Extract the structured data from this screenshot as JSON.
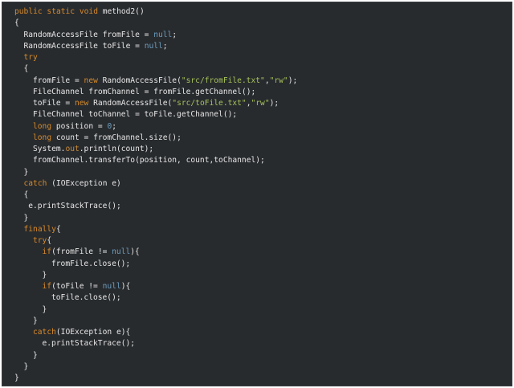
{
  "editor": {
    "lines": [
      {
        "indent": 0,
        "tokens": [
          {
            "t": "public static void ",
            "c": "kw"
          },
          {
            "t": "method2()",
            "c": "tx"
          }
        ]
      },
      {
        "indent": 0,
        "tokens": [
          {
            "t": "{",
            "c": "tx"
          }
        ]
      },
      {
        "indent": 1,
        "tokens": [
          {
            "t": "RandomAccessFile fromFile = ",
            "c": "tx"
          },
          {
            "t": "null",
            "c": "lit"
          },
          {
            "t": ";",
            "c": "tx"
          }
        ]
      },
      {
        "indent": 1,
        "tokens": [
          {
            "t": "RandomAccessFile toFile = ",
            "c": "tx"
          },
          {
            "t": "null",
            "c": "lit"
          },
          {
            "t": ";",
            "c": "tx"
          }
        ]
      },
      {
        "indent": 1,
        "tokens": [
          {
            "t": "try",
            "c": "kw"
          }
        ]
      },
      {
        "indent": 1,
        "tokens": [
          {
            "t": "{",
            "c": "tx"
          }
        ]
      },
      {
        "indent": 2,
        "tokens": [
          {
            "t": "fromFile = ",
            "c": "tx"
          },
          {
            "t": "new ",
            "c": "kw"
          },
          {
            "t": "RandomAccessFile(",
            "c": "tx"
          },
          {
            "t": "\"src/fromFile.txt\"",
            "c": "str"
          },
          {
            "t": ",",
            "c": "tx"
          },
          {
            "t": "\"rw\"",
            "c": "str"
          },
          {
            "t": ");",
            "c": "tx"
          }
        ]
      },
      {
        "indent": 2,
        "tokens": [
          {
            "t": "FileChannel fromChannel = fromFile.getChannel();",
            "c": "tx"
          }
        ]
      },
      {
        "indent": 2,
        "tokens": [
          {
            "t": "toFile = ",
            "c": "tx"
          },
          {
            "t": "new ",
            "c": "kw"
          },
          {
            "t": "RandomAccessFile(",
            "c": "tx"
          },
          {
            "t": "\"src/toFile.txt\"",
            "c": "str"
          },
          {
            "t": ",",
            "c": "tx"
          },
          {
            "t": "\"rw\"",
            "c": "str"
          },
          {
            "t": ");",
            "c": "tx"
          }
        ]
      },
      {
        "indent": 2,
        "tokens": [
          {
            "t": "FileChannel toChannel = toFile.getChannel();",
            "c": "tx"
          }
        ]
      },
      {
        "indent": 2,
        "tokens": [
          {
            "t": "long ",
            "c": "kw"
          },
          {
            "t": "position = ",
            "c": "tx"
          },
          {
            "t": "0",
            "c": "lit"
          },
          {
            "t": ";",
            "c": "tx"
          }
        ]
      },
      {
        "indent": 2,
        "tokens": [
          {
            "t": "long ",
            "c": "kw"
          },
          {
            "t": "count = fromChannel.size();",
            "c": "tx"
          }
        ]
      },
      {
        "indent": 2,
        "tokens": [
          {
            "t": "System.",
            "c": "tx"
          },
          {
            "t": "out",
            "c": "fld"
          },
          {
            "t": ".println(count);",
            "c": "tx"
          }
        ]
      },
      {
        "indent": 2,
        "tokens": [
          {
            "t": "fromChannel.transferTo(position, count,toChannel);",
            "c": "tx"
          }
        ]
      },
      {
        "indent": 1,
        "tokens": [
          {
            "t": "}",
            "c": "tx"
          }
        ]
      },
      {
        "indent": 1,
        "tokens": [
          {
            "t": "catch ",
            "c": "kw"
          },
          {
            "t": "(IOException e)",
            "c": "tx"
          }
        ]
      },
      {
        "indent": 1,
        "tokens": [
          {
            "t": "{",
            "c": "tx"
          }
        ]
      },
      {
        "indent": 1.5,
        "tokens": [
          {
            "t": "e.printStackTrace();",
            "c": "tx"
          }
        ]
      },
      {
        "indent": 1,
        "tokens": [
          {
            "t": "}",
            "c": "tx"
          }
        ]
      },
      {
        "indent": 1,
        "tokens": [
          {
            "t": "finally",
            "c": "kw"
          },
          {
            "t": "{",
            "c": "tx"
          }
        ]
      },
      {
        "indent": 2,
        "tokens": [
          {
            "t": "try",
            "c": "kw"
          },
          {
            "t": "{",
            "c": "tx"
          }
        ]
      },
      {
        "indent": 3,
        "tokens": [
          {
            "t": "if",
            "c": "kw"
          },
          {
            "t": "(fromFile != ",
            "c": "tx"
          },
          {
            "t": "null",
            "c": "lit"
          },
          {
            "t": "){",
            "c": "tx"
          }
        ]
      },
      {
        "indent": 4,
        "tokens": [
          {
            "t": "fromFile.close();",
            "c": "tx"
          }
        ]
      },
      {
        "indent": 3,
        "tokens": [
          {
            "t": "}",
            "c": "tx"
          }
        ]
      },
      {
        "indent": 3,
        "tokens": [
          {
            "t": "if",
            "c": "kw"
          },
          {
            "t": "(toFile != ",
            "c": "tx"
          },
          {
            "t": "null",
            "c": "lit"
          },
          {
            "t": "){",
            "c": "tx"
          }
        ]
      },
      {
        "indent": 4,
        "tokens": [
          {
            "t": "toFile.close();",
            "c": "tx"
          }
        ]
      },
      {
        "indent": 3,
        "tokens": [
          {
            "t": "}",
            "c": "tx"
          }
        ]
      },
      {
        "indent": 2,
        "tokens": [
          {
            "t": "}",
            "c": "tx"
          }
        ]
      },
      {
        "indent": 2,
        "tokens": [
          {
            "t": "catch",
            "c": "kw"
          },
          {
            "t": "(IOException e){",
            "c": "tx"
          }
        ]
      },
      {
        "indent": 3,
        "tokens": [
          {
            "t": "e.printStackTrace();",
            "c": "tx"
          }
        ]
      },
      {
        "indent": 2,
        "tokens": [
          {
            "t": "}",
            "c": "tx"
          }
        ]
      },
      {
        "indent": 1,
        "tokens": [
          {
            "t": "}",
            "c": "tx"
          }
        ]
      },
      {
        "indent": 0,
        "tokens": [
          {
            "t": "}",
            "c": "tx"
          }
        ]
      }
    ]
  }
}
